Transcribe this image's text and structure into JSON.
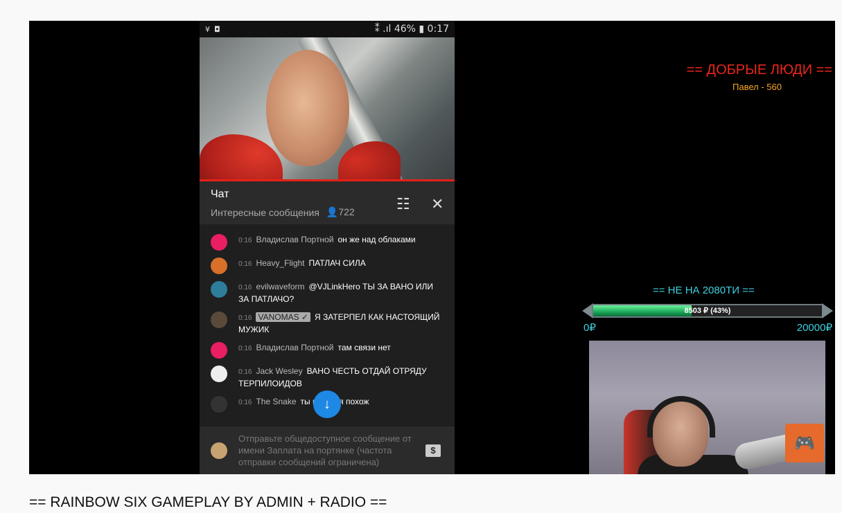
{
  "phone": {
    "status_left": [
      "¥",
      "◘"
    ],
    "status_right": "⁑ .ıl 46% ▮ 0:17"
  },
  "chat": {
    "title": "Чат",
    "subtitle": "Интересные сообщения",
    "viewers": "722",
    "messages": [
      {
        "time": "0:16",
        "author": "Владислав Портной",
        "text": "он же над облаками",
        "avatar_color": "#e91e63"
      },
      {
        "time": "0:16",
        "author": "Heavy_Flight",
        "text": "ПАТЛАЧ СИЛА",
        "avatar_color": "#d8702a"
      },
      {
        "time": "0:16",
        "author": "evilwaveform",
        "text": "@VJLinkHero ТЫ ЗА ВАНО ИЛИ ЗА ПАТЛАЧО?",
        "avatar_color": "#2e7d9a"
      },
      {
        "time": "0:16",
        "author": "VANOMAS ✓",
        "text": "Я ЗАТЕРПЕЛ КАК НАСТОЯЩИЙ МУЖИК",
        "avatar_color": "#5b4a3a",
        "badge": true
      },
      {
        "time": "0:16",
        "author": "Владислав Портной",
        "text": "там связи нет",
        "avatar_color": "#e91e63"
      },
      {
        "time": "0:16",
        "author": "Jack Wesley",
        "text": "ВАНО ЧЕСТЬ ОТДАЙ ОТРЯДУ ТЕРПИЛОИДОВ",
        "avatar_color": "#eeeeee"
      },
      {
        "time": "0:16",
        "author": "The Snake",
        "text": "ты на меня похож",
        "avatar_color": "#333333"
      }
    ],
    "input_placeholder": "Отправьте общедоступное сообщение от имени Заплата на портянке (частота отправки сообщений ограничена)",
    "dollar_label": "$"
  },
  "overlay": {
    "donors_title": "== ДОБРЫЕ ЛЮДИ ==",
    "donors_line": "Павел - 560",
    "goal_title": "== НЕ НА 2080ТИ ==",
    "goal_label": "8503 ₽ (43%)",
    "goal_fraction": 0.43,
    "goal_min": "0₽",
    "goal_max": "20000₽"
  },
  "caption": "== RAINBOW SIX GAMEPLAY BY ADMIN + RADIO =="
}
